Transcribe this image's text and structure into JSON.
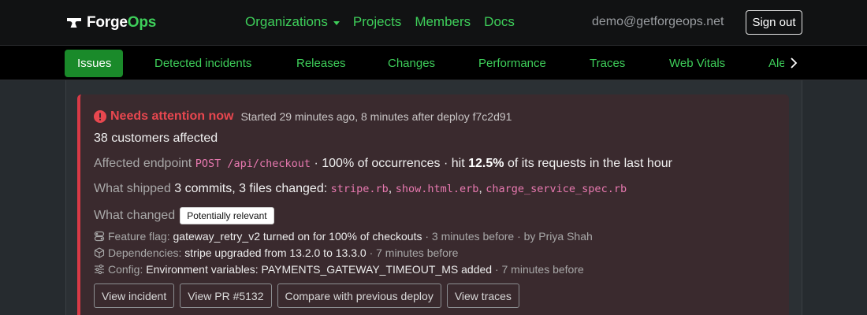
{
  "brand": {
    "name_part1": "Forge",
    "name_part2": "Ops"
  },
  "mainnav": {
    "organizations": "Organizations",
    "projects": "Projects",
    "members": "Members",
    "docs": "Docs"
  },
  "user": {
    "email": "demo@getforgeops.net",
    "signout_label": "Sign out"
  },
  "subnav": {
    "tabs": [
      "Issues",
      "Detected incidents",
      "Releases",
      "Changes",
      "Performance",
      "Traces",
      "Web Vitals",
      "Ale"
    ]
  },
  "incident": {
    "title": "Needs attention now",
    "meta": "Started 29 minutes ago, 8 minutes after deploy f7c2d91",
    "customers": "38 customers affected",
    "endpoint_label": "Affected endpoint",
    "endpoint_code": "POST /api/checkout",
    "endpoint_occ": "· 100% of occurrences · hit",
    "endpoint_pct": "12.5%",
    "endpoint_tail": "of its requests in the last hour",
    "shipped_label": "What shipped",
    "shipped_summary": "3 commits, 3 files changed:",
    "files": [
      "stripe.rb",
      "show.html.erb",
      "charge_service_spec.rb"
    ],
    "file_sep": ",",
    "changed_label": "What changed",
    "relevance_badge": "Potentially relevant",
    "changes": [
      {
        "label": "Feature flag:",
        "detail": "gateway_retry_v2 turned on for 100% of checkouts",
        "meta": "· 3 minutes before · by Priya Shah"
      },
      {
        "label": "Dependencies:",
        "detail": "stripe upgraded from 13.2.0 to 13.3.0",
        "meta": "· 7 minutes before"
      },
      {
        "label": "Config:",
        "detail": "Environment variables: PAYMENTS_GATEWAY_TIMEOUT_MS added",
        "meta": "· 7 minutes before"
      }
    ],
    "actions": [
      "View incident",
      "View PR #5132",
      "Compare with previous deploy",
      "View traces"
    ]
  },
  "colors": {
    "accent": "#3ecf5a",
    "danger": "#e8474f",
    "active_tab": "#1a8a2a",
    "code": "#e879b0"
  }
}
